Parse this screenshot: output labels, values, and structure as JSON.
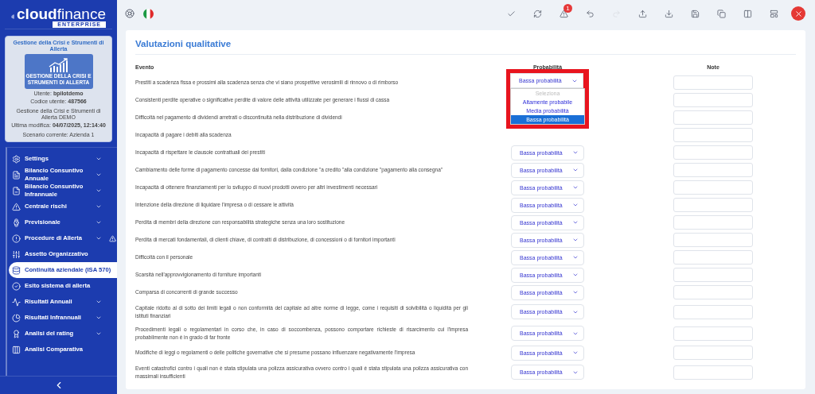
{
  "sidebar": {
    "logo": {
      "bold": "cloud",
      "light": "finance",
      "tag": "ENTERPRISE"
    },
    "profile": {
      "title": "Gestione della Crisi e Strumenti di Allerta",
      "badge_lines": [
        "GESTIONE DELLA CRISI E",
        "STRUMENTI DI ALLERTA"
      ],
      "user": "Utente: **bpilotdemo**",
      "code": "Codice utente: **487566**",
      "product": "Gestione della Crisi e Strumenti di Allerta DEMO",
      "modified": "Ultima modifica: **04/07/2025, 12:14:40**",
      "scenario": "Scenario corrente: Azienda 1"
    },
    "items": [
      {
        "label": "Settings",
        "expandable": true,
        "selected": false,
        "warning": false
      },
      {
        "label": "Bilancio Consuntivo Annuale",
        "expandable": true,
        "selected": false,
        "warning": false
      },
      {
        "label": "Bilancio Consuntivo Infrannuale",
        "expandable": true,
        "selected": false,
        "warning": false
      },
      {
        "label": "Centrale rischi",
        "expandable": true,
        "selected": false,
        "warning": false
      },
      {
        "label": "Previsionale",
        "expandable": true,
        "selected": false,
        "warning": false
      },
      {
        "label": "Procedure di Allerta",
        "expandable": true,
        "selected": false,
        "warning": true
      },
      {
        "label": "Assetto Organizzativo",
        "expandable": false,
        "selected": false,
        "warning": false
      },
      {
        "label": "Continuità aziendale (ISA 570)",
        "expandable": false,
        "selected": true,
        "warning": false
      },
      {
        "label": "Esito sistema di allerta",
        "expandable": false,
        "selected": false,
        "warning": false
      },
      {
        "label": "Risultati Annuali",
        "expandable": true,
        "selected": false,
        "warning": false
      },
      {
        "label": "Risultati Infrannuali",
        "expandable": true,
        "selected": false,
        "warning": false
      },
      {
        "label": "Analisi del rating",
        "expandable": true,
        "selected": false,
        "warning": false
      },
      {
        "label": "Analisi Comparativa",
        "expandable": false,
        "selected": false,
        "warning": false
      }
    ]
  },
  "toolbar": {
    "buttons": [
      {
        "disabled": false
      },
      {
        "disabled": false
      },
      {
        "disabled": false,
        "badge": "1"
      },
      {
        "disabled": false
      },
      {
        "disabled": true
      },
      {
        "disabled": false
      },
      {
        "disabled": false
      },
      {
        "disabled": false
      },
      {
        "disabled": false
      },
      {
        "disabled": false
      },
      {
        "disabled": false
      }
    ]
  },
  "panel": {
    "title": "Valutazioni qualitative",
    "columns": [
      "Evento",
      "Probabilità",
      "Note"
    ],
    "rows": [
      {
        "event": "Prestiti a scadenza fissa e prossimi alla scadenza senza che vi siano prospettive verosimili di rinnovo o di rimborso",
        "probability": "Bassa probabilità",
        "dropdown": {
          "open": true,
          "highlighted": true,
          "options": [
            {
              "label": "Seleziona",
              "kind": "placeholder",
              "selected": false
            },
            {
              "label": "Altamente probabile",
              "kind": "option",
              "selected": false
            },
            {
              "label": "Media probabilità",
              "kind": "option",
              "selected": false
            },
            {
              "label": "Bassa probabilità",
              "kind": "option",
              "selected": true
            }
          ]
        }
      },
      {
        "event": "Consistenti perdite operative o significative perdite di valore delle attività utilizzate per generare i flussi di cassa"
      },
      {
        "event": "Difficoltà nel pagamento di dividendi arretrati o discontinuità nella distribuzione di dividendi"
      },
      {
        "event": "Incapacità di pagare i debiti alla scadenza"
      },
      {
        "event": "Incapacità di rispettare le clausole contrattuali dei prestiti",
        "probability": "Bassa probabilità"
      },
      {
        "event": "Cambiamento delle forme di pagamento concesse dai fornitori, dalla condizione \"a credito \"alla condizione \"pagamento alla consegna\"",
        "probability": "Bassa probabilità"
      },
      {
        "event": "Incapacità di ottenere finanziamenti per lo sviluppo di nuovi prodotti ovvero per altri investimenti necessari",
        "probability": "Bassa probabilità"
      },
      {
        "event": "Intenzione della direzione di liquidare l'impresa o di cessare le attività",
        "probability": "Bassa probabilità"
      },
      {
        "event": "Perdita di membri della direzione con responsabilità strategiche senza una loro sostituzione",
        "probability": "Bassa probabilità"
      },
      {
        "event": "Perdita di mercati fondamentali, di clienti chiave, di contratti di distribuzione, di concessioni o di fornitori importanti",
        "probability": "Bassa probabilità"
      },
      {
        "event": "Difficoltà con il personale",
        "probability": "Bassa probabilità"
      },
      {
        "event": "Scarsità nell'approvvigionamento di forniture importanti",
        "probability": "Bassa probabilità"
      },
      {
        "event": "Comparsa di concorrenti di grande successo",
        "probability": "Bassa probabilità"
      },
      {
        "event": "Capitale ridotto al di sotto dei limiti legali o non conformità del capitale ad altre norme di legge, come i requisiti di solvibilità o liquidità per gli istituti finanziari",
        "probability": "Bassa probabilità"
      },
      {
        "event": "Procedimenti legali o regolamentari in corso che, in caso di soccombenza, possono comportare richieste di risarcimento cui l'impresa probabilmente non è in grado di far fronte",
        "probability": "Bassa probabilità"
      },
      {
        "event": "Modifiche di leggi o regolamenti o delle politiche governative che si presume possano influenzare negativamente l'impresa",
        "probability": "Bassa probabilità"
      },
      {
        "event": "Eventi catastrofici contro i quali non è stata stipulata una polizza assicurativa ovvero contro i quali è stata stipulata una polizza assicurativa con massimali insufficienti",
        "probability": "Bassa probabilità"
      }
    ]
  }
}
